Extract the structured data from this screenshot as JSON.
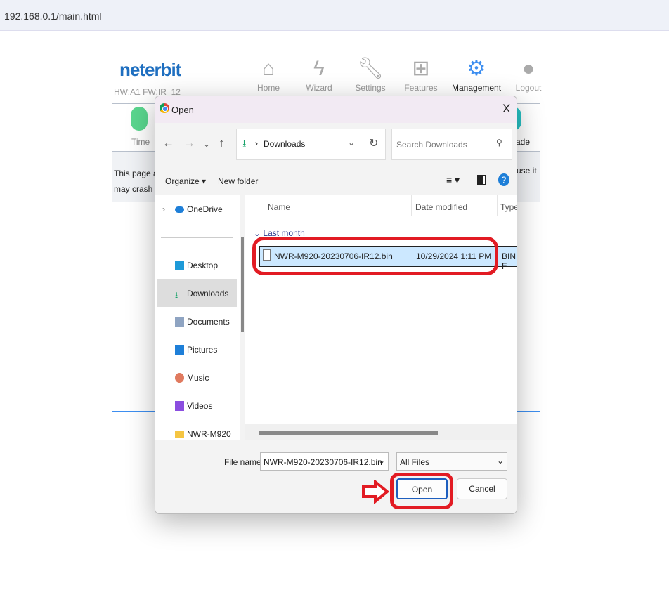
{
  "browser": {
    "url": "192.168.0.1/main.html"
  },
  "router": {
    "logo": "neterbit",
    "hw_fw": "HW:A1 FW:IR_12",
    "nav": [
      {
        "label": "Home",
        "icon": "home-icon"
      },
      {
        "label": "Wizard",
        "icon": "wizard-icon"
      },
      {
        "label": "Settings",
        "icon": "wrench-icon"
      },
      {
        "label": "Features",
        "icon": "features-icon"
      },
      {
        "label": "Management",
        "icon": "gear-icon",
        "active": true
      },
      {
        "label": "Logout",
        "icon": "logout-icon"
      }
    ],
    "subnav": {
      "time": "Time",
      "upgrade": "ade"
    },
    "text_left_1": "This page allo",
    "text_left_2": "may crash the",
    "text_right": "use it"
  },
  "dialog": {
    "title": "Open",
    "close": "X",
    "breadcrumb": "Downloads",
    "search_placeholder": "Search Downloads",
    "organize": "Organize ▾",
    "new_folder": "New folder",
    "nav_items": [
      {
        "label": "OneDrive"
      },
      {
        "label": "Desktop"
      },
      {
        "label": "Downloads",
        "selected": true
      },
      {
        "label": "Documents"
      },
      {
        "label": "Pictures"
      },
      {
        "label": "Music"
      },
      {
        "label": "Videos"
      },
      {
        "label": "NWR-M920"
      }
    ],
    "columns": [
      "Name",
      "Date modified",
      "Type"
    ],
    "group": "Last month",
    "files": [
      {
        "name": "NWR-M920-20230706-IR12.bin",
        "date": "10/29/2024 1:11 PM",
        "type": "BIN F"
      }
    ],
    "file_name_label": "File name:",
    "file_name_value": "NWR-M920-20230706-IR12.bin",
    "filter": "All Files",
    "open": "Open",
    "cancel": "Cancel"
  },
  "colors": {
    "highlight": "#e21b23",
    "accent": "#1f6fc0",
    "selection": "#cce8ff"
  }
}
